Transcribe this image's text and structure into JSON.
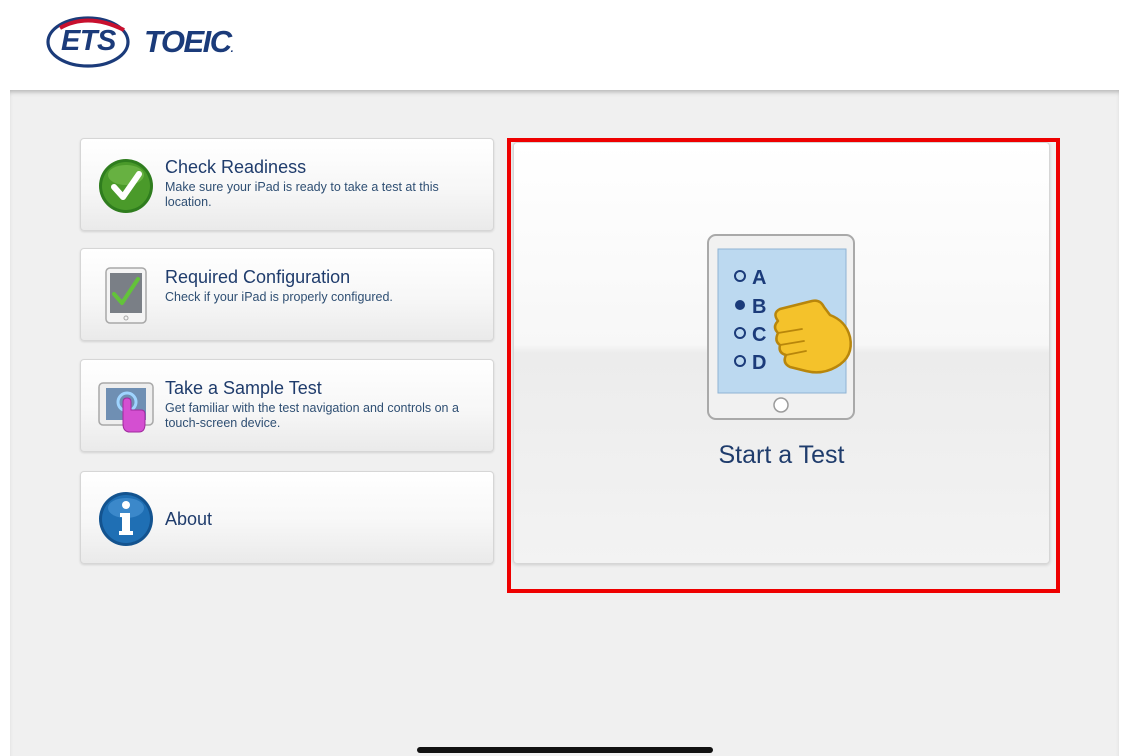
{
  "header": {
    "logo_ets": "ETS",
    "logo_toeic": "TOEIC",
    "logo_toeic_mark": "."
  },
  "menu": [
    {
      "title": "Check Readiness",
      "description": "Make sure your iPad is ready to take a test at this location.",
      "icon": "green-checkmark-icon"
    },
    {
      "title": "Required Configuration",
      "description": "Check if your iPad is properly configured.",
      "icon": "tablet-checkmark-icon"
    },
    {
      "title": "Take a Sample Test",
      "description": "Get familiar with the test navigation and controls on a touch-screen device.",
      "icon": "touch-tablet-icon"
    },
    {
      "title": "About",
      "icon": "info-icon"
    }
  ],
  "start_test": {
    "label": "Start a Test",
    "icon": "tablet-answer-sheet-icon",
    "options": [
      "A",
      "B",
      "C",
      "D"
    ],
    "selected_option": "B"
  },
  "colors": {
    "brand_navy": "#1b3b7a",
    "label_blue": "#1f3c6c",
    "highlight_red": "#ee0000",
    "check_green": "#4a9a2a",
    "info_blue": "#1f6fb4"
  }
}
